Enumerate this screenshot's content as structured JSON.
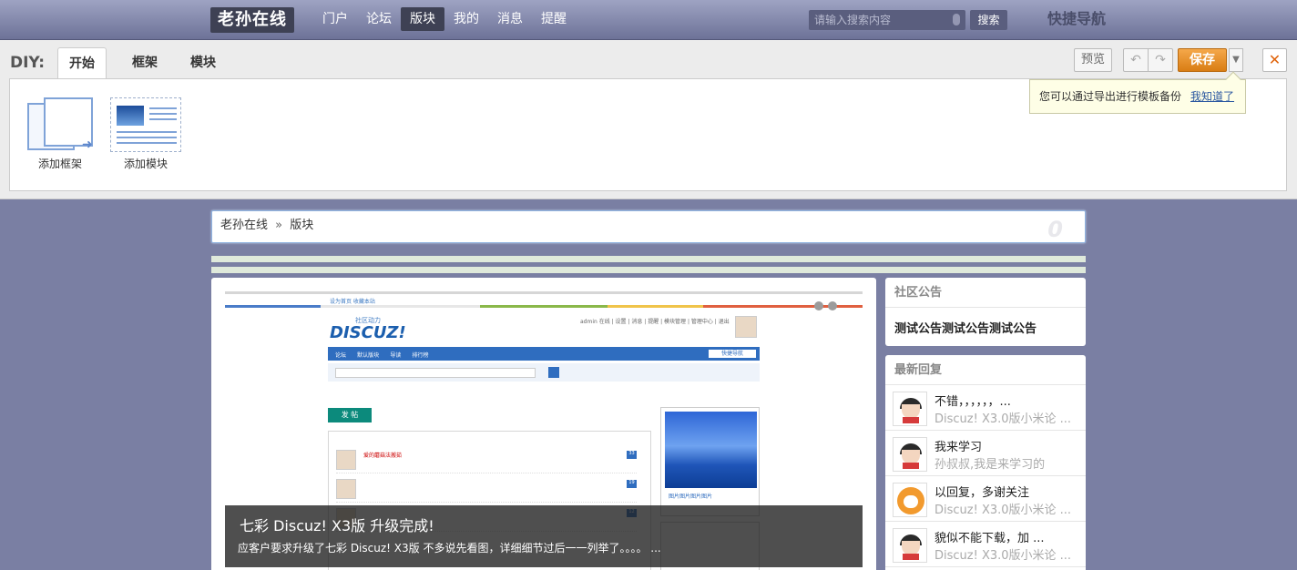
{
  "topnav": {
    "logo": "老孙在线",
    "links": [
      "门户",
      "论坛",
      "版块",
      "我的",
      "消息",
      "提醒"
    ],
    "active_index": 2,
    "search_placeholder": "请输入搜索内容",
    "search_button": "搜索",
    "quick_nav": "快捷导航"
  },
  "diy": {
    "label": "DIY:",
    "tabs": [
      "开始",
      "框架",
      "模块"
    ],
    "active_tab": "开始",
    "tools": {
      "add_frame": "添加框架",
      "add_module": "添加模块"
    },
    "buttons": {
      "preview": "预览",
      "undo_icon": "undo-icon",
      "redo_icon": "redo-icon",
      "save": "保存",
      "save_more_icon": "chevron-down-icon",
      "close": "✕"
    },
    "tip": {
      "text": "您可以通过导出进行模板备份",
      "link": "我知道了"
    }
  },
  "breadcrumb": {
    "home": "老孙在线",
    "separator": "»",
    "current": "版块",
    "badge": "0"
  },
  "slide": {
    "caption_title": "七彩 Discuz! X3版 升级完成!",
    "caption_desc": "应客户要求升级了七彩 Discuz! X3版 不多说先看图，详细细节过后一一列举了。。。。 ...",
    "mini": {
      "top_links": "设为首页  收藏本站",
      "brand_small": "社区动力",
      "brand": "DISCUZ!",
      "user_line": "admin 在线 | 设置 | 消息 | 提醒 | 模块管理 | 管理中心 | 退出",
      "nav_items": [
        "论坛",
        "默认版块",
        "导读",
        "排行榜"
      ],
      "quick_nav": "快捷导航",
      "post_button": "发 帖",
      "side_caption": "图片图片图片图片",
      "row_title": "爱的蘑菇法搬茹"
    }
  },
  "sidebar": {
    "notice": {
      "title": "社区公告",
      "text": "测试公告测试公告测试公告"
    },
    "replies": {
      "title": "最新回复",
      "items": [
        {
          "title": "不错，，，，，，...",
          "sub": "Discuz! X3.0版小米论 ...",
          "avatar": "boy-avatar"
        },
        {
          "title": "我来学习",
          "sub": "孙叔叔,我是来学习的",
          "avatar": "boy-avatar"
        },
        {
          "title": "以回复，多谢关注",
          "sub": "Discuz! X3.0版小米论 ...",
          "avatar": "fox-avatar"
        },
        {
          "title": "貌似不能下载，加 ...",
          "sub": "Discuz! X3.0版小米论 ...",
          "avatar": "boy-avatar"
        }
      ]
    }
  },
  "colors": {
    "page_bg": "#7a7fa3",
    "save_orange": "#e08a1e",
    "accent_blue": "#2a57a0"
  }
}
